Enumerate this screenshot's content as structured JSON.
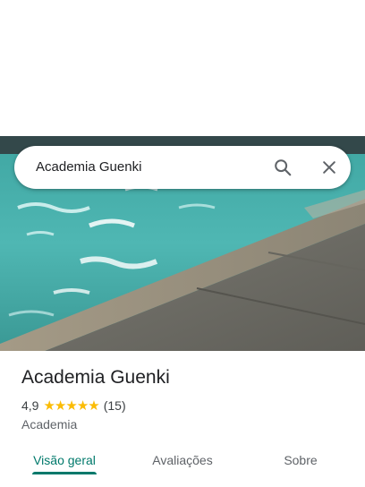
{
  "search": {
    "query": "Academia Guenki"
  },
  "place": {
    "name": "Academia Guenki",
    "rating": "4,9",
    "stars_filled": 5,
    "review_count": "(15)",
    "category": "Academia"
  },
  "tabs": [
    {
      "label": "Visão geral",
      "active": true
    },
    {
      "label": "Avaliações",
      "active": false
    },
    {
      "label": "Sobre",
      "active": false
    }
  ],
  "colors": {
    "accent": "#00796b",
    "star": "#fbbc04"
  },
  "icons": {
    "search": "search-icon",
    "close": "close-icon",
    "star": "star-icon"
  }
}
